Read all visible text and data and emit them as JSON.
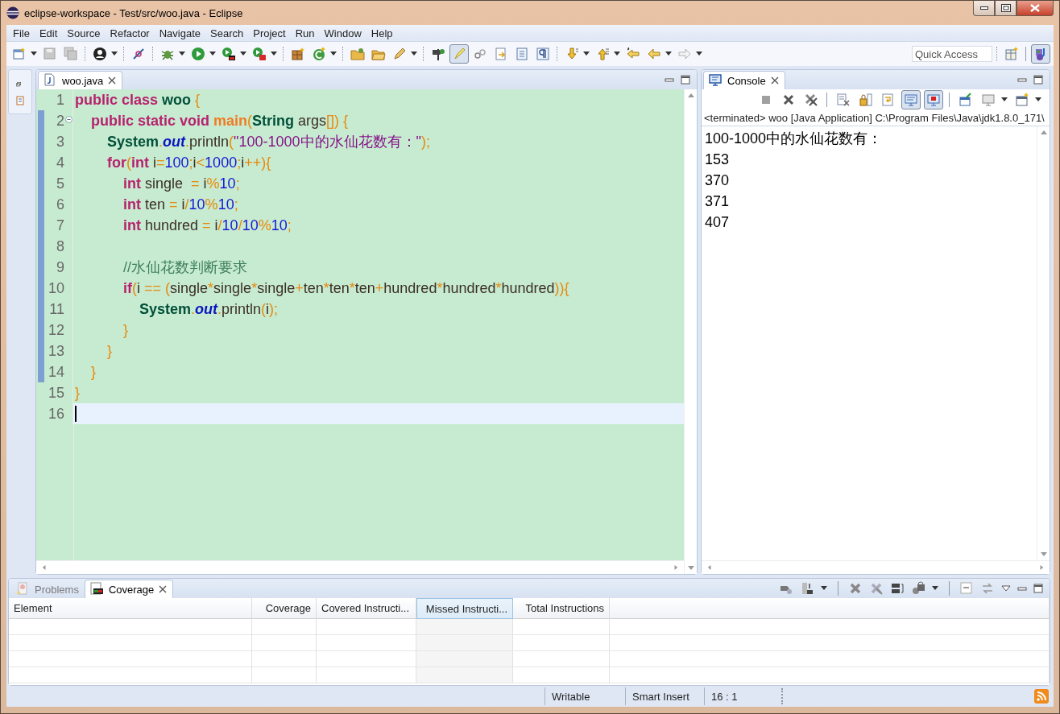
{
  "window": {
    "title": "eclipse-workspace - Test/src/woo.java - Eclipse"
  },
  "menu": [
    "File",
    "Edit",
    "Source",
    "Refactor",
    "Navigate",
    "Search",
    "Project",
    "Run",
    "Window",
    "Help"
  ],
  "quick_access": {
    "placeholder": "Quick Access"
  },
  "editor": {
    "tabs": [
      {
        "label": "woo.java",
        "selected": true
      }
    ],
    "lines": [
      {
        "number": "1",
        "changed": false,
        "foldable": false,
        "current": false,
        "tokens": [
          {
            "text": "public class ",
            "kind": "kw"
          },
          {
            "text": "woo ",
            "kind": "cls"
          },
          {
            "text": "{",
            "kind": "op"
          }
        ]
      },
      {
        "number": "2",
        "changed": true,
        "foldable": true,
        "current": false,
        "tokens": [
          {
            "text": "    public static void ",
            "kind": "kw"
          },
          {
            "text": "main",
            "kind": "method"
          },
          {
            "text": "(",
            "kind": "op"
          },
          {
            "text": "String",
            "kind": "cls"
          },
          {
            "text": " args",
            "kind": "plain"
          },
          {
            "text": "[])",
            "kind": "op"
          },
          {
            "text": " {",
            "kind": "op"
          }
        ]
      },
      {
        "number": "3",
        "changed": true,
        "foldable": false,
        "current": false,
        "tokens": [
          {
            "text": "        System",
            "kind": "cls"
          },
          {
            "text": ".",
            "kind": "op"
          },
          {
            "text": "out",
            "kind": "field"
          },
          {
            "text": ".",
            "kind": "op"
          },
          {
            "text": "println",
            "kind": "plain"
          },
          {
            "text": "(",
            "kind": "op"
          },
          {
            "text": "\"100-1000中的水仙花数有：\"",
            "kind": "str"
          },
          {
            "text": ");",
            "kind": "op"
          }
        ]
      },
      {
        "number": "4",
        "changed": true,
        "foldable": false,
        "current": false,
        "tokens": [
          {
            "text": "        for",
            "kind": "kw"
          },
          {
            "text": "(",
            "kind": "op"
          },
          {
            "text": "int",
            "kind": "kw"
          },
          {
            "text": " i",
            "kind": "plain"
          },
          {
            "text": "=",
            "kind": "op"
          },
          {
            "text": "100",
            "kind": "num"
          },
          {
            "text": ";",
            "kind": "op"
          },
          {
            "text": "i",
            "kind": "plain"
          },
          {
            "text": "<",
            "kind": "op"
          },
          {
            "text": "1000",
            "kind": "num"
          },
          {
            "text": ";",
            "kind": "op"
          },
          {
            "text": "i",
            "kind": "plain"
          },
          {
            "text": "++){",
            "kind": "op"
          }
        ]
      },
      {
        "number": "5",
        "changed": true,
        "foldable": false,
        "current": false,
        "tokens": [
          {
            "text": "            int",
            "kind": "kw"
          },
          {
            "text": " single  ",
            "kind": "plain"
          },
          {
            "text": "=",
            "kind": "op"
          },
          {
            "text": " i",
            "kind": "plain"
          },
          {
            "text": "%",
            "kind": "op"
          },
          {
            "text": "10",
            "kind": "num"
          },
          {
            "text": ";",
            "kind": "op"
          }
        ]
      },
      {
        "number": "6",
        "changed": true,
        "foldable": false,
        "current": false,
        "tokens": [
          {
            "text": "            int",
            "kind": "kw"
          },
          {
            "text": " ten ",
            "kind": "plain"
          },
          {
            "text": "=",
            "kind": "op"
          },
          {
            "text": " i",
            "kind": "plain"
          },
          {
            "text": "/",
            "kind": "op"
          },
          {
            "text": "10",
            "kind": "num"
          },
          {
            "text": "%",
            "kind": "op"
          },
          {
            "text": "10",
            "kind": "num"
          },
          {
            "text": ";",
            "kind": "op"
          }
        ]
      },
      {
        "number": "7",
        "changed": true,
        "foldable": false,
        "current": false,
        "tokens": [
          {
            "text": "            int",
            "kind": "kw"
          },
          {
            "text": " hundred ",
            "kind": "plain"
          },
          {
            "text": "=",
            "kind": "op"
          },
          {
            "text": " i",
            "kind": "plain"
          },
          {
            "text": "/",
            "kind": "op"
          },
          {
            "text": "10",
            "kind": "num"
          },
          {
            "text": "/",
            "kind": "op"
          },
          {
            "text": "10",
            "kind": "num"
          },
          {
            "text": "%",
            "kind": "op"
          },
          {
            "text": "10",
            "kind": "num"
          },
          {
            "text": ";",
            "kind": "op"
          }
        ]
      },
      {
        "number": "8",
        "changed": true,
        "foldable": false,
        "current": false
      },
      {
        "number": "9",
        "changed": true,
        "foldable": false,
        "current": false,
        "tokens": [
          {
            "text": "            //水仙花数判断要求",
            "kind": "comment"
          }
        ]
      },
      {
        "number": "10",
        "changed": true,
        "foldable": false,
        "current": false,
        "tokens": [
          {
            "text": "            if",
            "kind": "kw"
          },
          {
            "text": "(",
            "kind": "op"
          },
          {
            "text": "i ",
            "kind": "plain"
          },
          {
            "text": "==",
            "kind": "op"
          },
          {
            "text": " (",
            "kind": "op"
          },
          {
            "text": "single",
            "kind": "plain"
          },
          {
            "text": "*",
            "kind": "op"
          },
          {
            "text": "single",
            "kind": "plain"
          },
          {
            "text": "*",
            "kind": "op"
          },
          {
            "text": "single",
            "kind": "plain"
          },
          {
            "text": "+",
            "kind": "op"
          },
          {
            "text": "ten",
            "kind": "plain"
          },
          {
            "text": "*",
            "kind": "op"
          },
          {
            "text": "ten",
            "kind": "plain"
          },
          {
            "text": "*",
            "kind": "op"
          },
          {
            "text": "ten",
            "kind": "plain"
          },
          {
            "text": "+",
            "kind": "op"
          },
          {
            "text": "hundred",
            "kind": "plain"
          },
          {
            "text": "*",
            "kind": "op"
          },
          {
            "text": "hundred",
            "kind": "plain"
          },
          {
            "text": "*",
            "kind": "op"
          },
          {
            "text": "hundred",
            "kind": "plain"
          },
          {
            "text": ")){",
            "kind": "op"
          }
        ]
      },
      {
        "number": "11",
        "changed": true,
        "foldable": false,
        "current": false,
        "tokens": [
          {
            "text": "                System",
            "kind": "cls"
          },
          {
            "text": ".",
            "kind": "op"
          },
          {
            "text": "out",
            "kind": "field"
          },
          {
            "text": ".",
            "kind": "op"
          },
          {
            "text": "println",
            "kind": "plain"
          },
          {
            "text": "(",
            "kind": "op"
          },
          {
            "text": "i",
            "kind": "plain"
          },
          {
            "text": ");",
            "kind": "op"
          }
        ]
      },
      {
        "number": "12",
        "changed": true,
        "foldable": false,
        "current": false,
        "tokens": [
          {
            "text": "            }",
            "kind": "op"
          }
        ]
      },
      {
        "number": "13",
        "changed": true,
        "foldable": false,
        "current": false,
        "tokens": [
          {
            "text": "        }",
            "kind": "op"
          }
        ]
      },
      {
        "number": "14",
        "changed": true,
        "foldable": false,
        "current": false,
        "tokens": [
          {
            "text": "    }",
            "kind": "op"
          }
        ]
      },
      {
        "number": "15",
        "changed": false,
        "foldable": false,
        "current": false,
        "tokens": [
          {
            "text": "}",
            "kind": "op"
          }
        ]
      },
      {
        "number": "16",
        "changed": false,
        "foldable": false,
        "current": true
      }
    ]
  },
  "console": {
    "tabs": [
      {
        "label": "Console",
        "selected": true
      }
    ],
    "status": "<terminated> woo [Java Application] C:\\Program Files\\Java\\jdk1.8.0_171\\",
    "output": [
      "100-1000中的水仙花数有：",
      "153",
      "370",
      "371",
      "407"
    ]
  },
  "bottom_panel": {
    "tabs": [
      {
        "label": "Problems",
        "selected": false,
        "closable": false
      },
      {
        "label": "Coverage",
        "selected": true,
        "closable": true
      }
    ],
    "table": {
      "columns": [
        {
          "label": "Element",
          "sorted": false,
          "kind": "left"
        },
        {
          "label": "Coverage",
          "sorted": false,
          "kind": "right"
        },
        {
          "label": "Covered Instructi...",
          "sorted": false,
          "kind": "left"
        },
        {
          "label": "Missed Instructi...",
          "sorted": true,
          "kind": "right"
        },
        {
          "label": "Total Instructions",
          "sorted": false,
          "kind": "right"
        }
      ]
    }
  },
  "status_bar": [
    "Writable",
    "Smart Insert",
    "16 : 1"
  ]
}
